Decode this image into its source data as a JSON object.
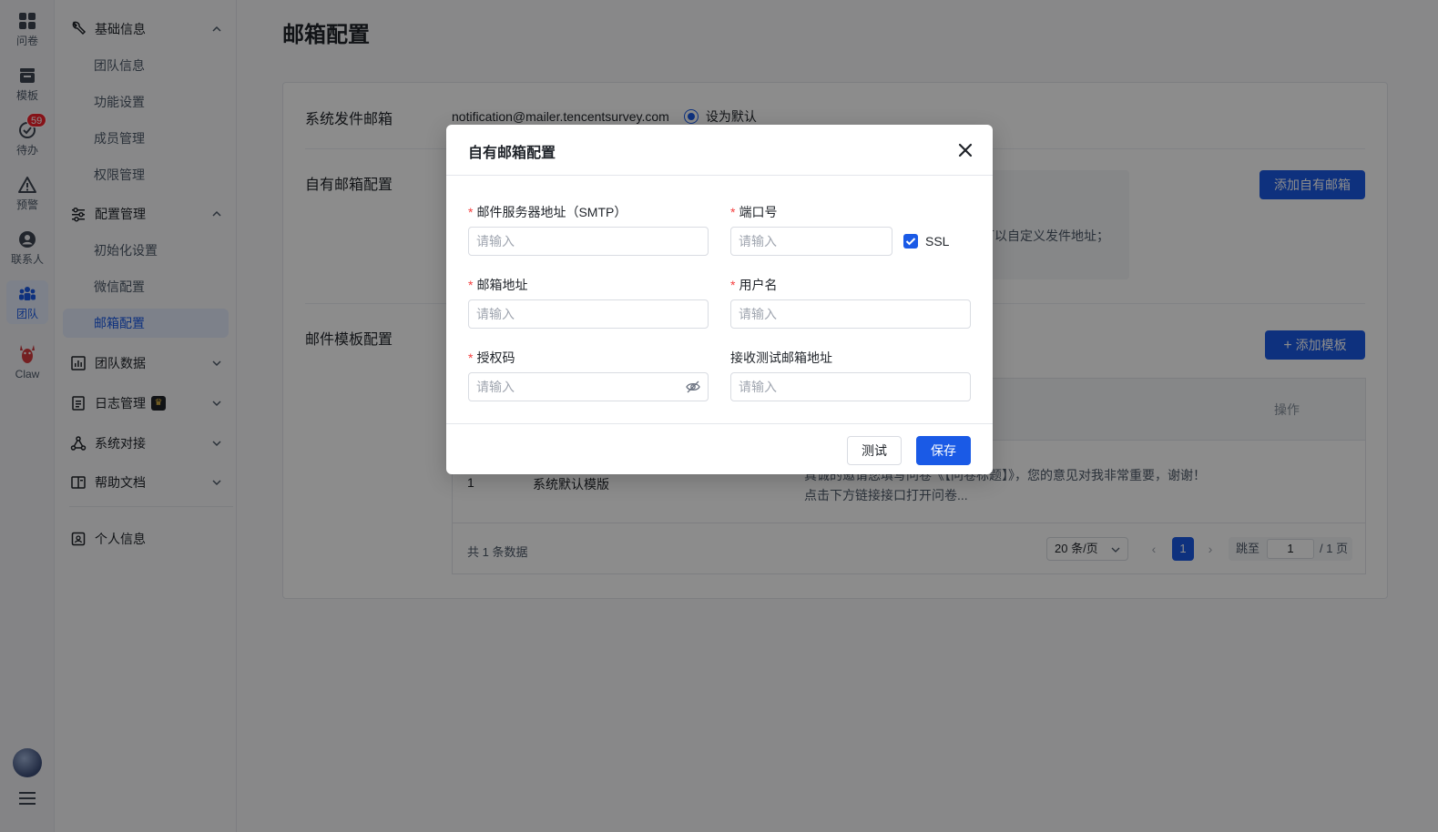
{
  "rail": {
    "items": [
      {
        "label": "问卷",
        "icon": "grid-icon"
      },
      {
        "label": "模板",
        "icon": "template-icon"
      },
      {
        "label": "待办",
        "icon": "check-circle-icon",
        "badge": "59"
      },
      {
        "label": "预警",
        "icon": "warning-icon"
      },
      {
        "label": "联系人",
        "icon": "contact-icon"
      },
      {
        "label": "团队",
        "icon": "team-icon"
      },
      {
        "label": "Claw",
        "icon": "lobster-icon"
      }
    ]
  },
  "menu": {
    "basic": {
      "label": "基础信息",
      "subs": [
        "团队信息",
        "功能设置",
        "成员管理",
        "权限管理"
      ]
    },
    "config": {
      "label": "配置管理",
      "subs": [
        "初始化设置",
        "微信配置",
        "邮箱配置"
      ]
    },
    "team_data": "团队数据",
    "logs": "日志管理",
    "integration": "系统对接",
    "help": "帮助文档",
    "profile": "个人信息"
  },
  "page": {
    "title": "邮箱配置",
    "system_sender_label": "系统发件邮箱",
    "system_sender_email": "notification@mailer.tencentsurvey.com",
    "set_default_label": "设为默认",
    "own_mailbox_label": "自有邮箱配置",
    "own_mailbox_tip": "可以自定义发件地址；",
    "add_own_mailbox": "添加自有邮箱",
    "template_label": "邮件模板配置",
    "add_template": "添加模板",
    "table": {
      "op_header": "操作",
      "rows": [
        {
          "index": "1",
          "name": "系统默认模版",
          "content_line1": "真诚的邀请您填写问卷《【问卷标题】》，您的意见对我非常重要，谢谢！",
          "content_line2": "点击下方链接接口打开问卷..."
        }
      ],
      "total": "共 1 条数据",
      "page_size": "20 条/页",
      "current_page": "1",
      "jump_label": "跳至",
      "jump_value": "1",
      "total_pages": "/ 1 页"
    }
  },
  "modal": {
    "title": "自有邮箱配置",
    "smtp_label": "邮件服务器地址（SMTP）",
    "port_label": "端口号",
    "email_label": "邮箱地址",
    "username_label": "用户名",
    "auth_label": "授权码",
    "test_email_label": "接收测试邮箱地址",
    "placeholder": "请输入",
    "ssl_label": "SSL",
    "ssl_checked": true,
    "test_button": "测试",
    "save_button": "保存"
  },
  "colors": {
    "primary": "#1a5ae6",
    "required": "#f53f3f",
    "badge": "#f5222d"
  }
}
